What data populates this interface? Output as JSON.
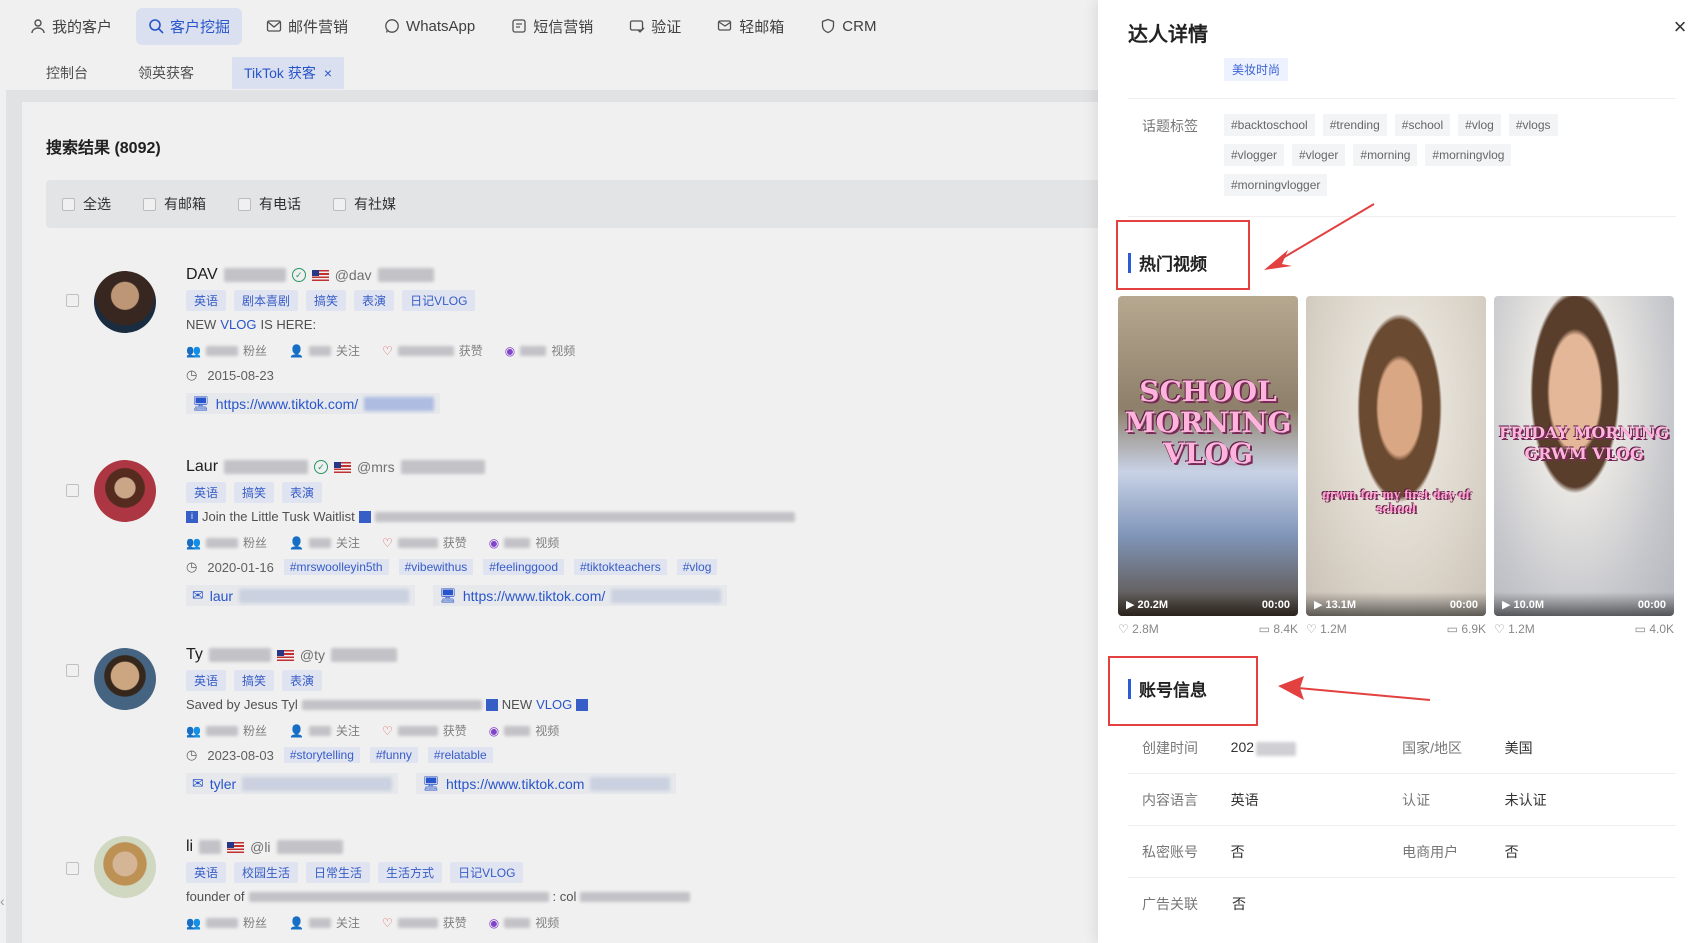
{
  "nav": {
    "items": [
      {
        "label": "我的客户",
        "icon": "user-icon"
      },
      {
        "label": "客户挖掘",
        "icon": "search-icon",
        "active": true
      },
      {
        "label": "邮件营销",
        "icon": "mail-icon"
      },
      {
        "label": "WhatsApp",
        "icon": "whatsapp-icon"
      },
      {
        "label": "短信营销",
        "icon": "sms-icon"
      },
      {
        "label": "验证",
        "icon": "verify-mail-icon"
      },
      {
        "label": "轻邮箱",
        "icon": "light-mail-icon"
      },
      {
        "label": "CRM",
        "icon": "crm-icon"
      }
    ]
  },
  "subnav": {
    "items": [
      "控制台",
      "领英获客"
    ],
    "active_tab": "TikTok 获客",
    "close": "×"
  },
  "results": {
    "title": "搜索结果 (8092)",
    "filters": [
      "全选",
      "有邮箱",
      "有电话",
      "有社媒"
    ]
  },
  "creators": [
    {
      "name": "DAV",
      "handle": "@dav",
      "tags": [
        "英语",
        "剧本喜剧",
        "搞笑",
        "表演",
        "日记VLOG"
      ],
      "bio_pre": "NEW ",
      "bio_hl": "VLOG",
      "bio_post": " IS HERE:",
      "stats": [
        "粉丝",
        "关注",
        "获赞",
        "视频"
      ],
      "date": "2015-08-23",
      "hashtags": [],
      "email": "",
      "link": "https://www.tiktok.com/"
    },
    {
      "name": "Laur",
      "handle": "@mrs",
      "tags": [
        "英语",
        "搞笑",
        "表演"
      ],
      "bio_pre": "Join the Little Tusk Waitlist",
      "bio_hl": "",
      "bio_post": "",
      "stats": [
        "粉丝",
        "关注",
        "获赞",
        "视频"
      ],
      "date": "2020-01-16",
      "hashtags": [
        "#mrswoolleyin5th",
        "#vibewithus",
        "#feelinggood",
        "#tiktokteachers",
        "#vlog"
      ],
      "email": "laur",
      "link": "https://www.tiktok.com/"
    },
    {
      "name": "Ty",
      "handle": "@ty",
      "tags": [
        "英语",
        "搞笑",
        "表演"
      ],
      "bio_pre": "Saved by Jesus Tyl",
      "bio_hl": "VLOG",
      "bio_post": "",
      "bio_mid": "NEW ",
      "stats": [
        "粉丝",
        "关注",
        "获赞",
        "视频"
      ],
      "date": "2023-08-03",
      "hashtags": [
        "#storytelling",
        "#funny",
        "#relatable"
      ],
      "email": "tyler",
      "link": "https://www.tiktok.com"
    },
    {
      "name": "li",
      "handle": "@li",
      "tags": [
        "英语",
        "校园生活",
        "日常生活",
        "生活方式",
        "日记VLOG"
      ],
      "bio_pre": "founder of",
      "bio_hl": "",
      "bio_post": ": col",
      "stats": [
        "粉丝",
        "关注",
        "获赞",
        "视频"
      ],
      "date": "",
      "hashtags": [],
      "email": "",
      "link": ""
    }
  ],
  "drawer": {
    "title": "达人详情",
    "close": "×",
    "category_tag": "美妆时尚",
    "topic_label": "话题标签",
    "topic_tags": [
      "#backtoschool",
      "#trending",
      "#school",
      "#vlog",
      "#vlogs",
      "#vlogger",
      "#vloger",
      "#morning",
      "#morningvlog",
      "#morningvlogger"
    ],
    "hot_videos_title": "热门视频",
    "videos": [
      {
        "overlay": "SCHOOL MORNING VLOG",
        "plays": "▶ 20.2M",
        "duration": "00:00",
        "likes": "2.8M",
        "comments": "8.4K"
      },
      {
        "overlay": "grwm for my first day of school",
        "plays": "▶ 13.1M",
        "duration": "00:00",
        "likes": "1.2M",
        "comments": "6.9K"
      },
      {
        "overlay": "FRIDAY MORNING GRWM VLOG",
        "plays": "▶ 10.0M",
        "duration": "00:00",
        "likes": "1.2M",
        "comments": "4.0K"
      }
    ],
    "account_title": "账号信息",
    "account_info": [
      {
        "label": "创建时间",
        "value": "202",
        "label2": "国家/地区",
        "value2": "美国"
      },
      {
        "label": "内容语言",
        "value": "英语",
        "label2": "认证",
        "value2": "未认证"
      },
      {
        "label": "私密账号",
        "value": "否",
        "label2": "电商用户",
        "value2": "否"
      },
      {
        "label": "广告关联",
        "value": "否",
        "label2": "",
        "value2": ""
      }
    ]
  },
  "colors": {
    "accent": "#2b5bd7",
    "annotation": "#e34040"
  }
}
